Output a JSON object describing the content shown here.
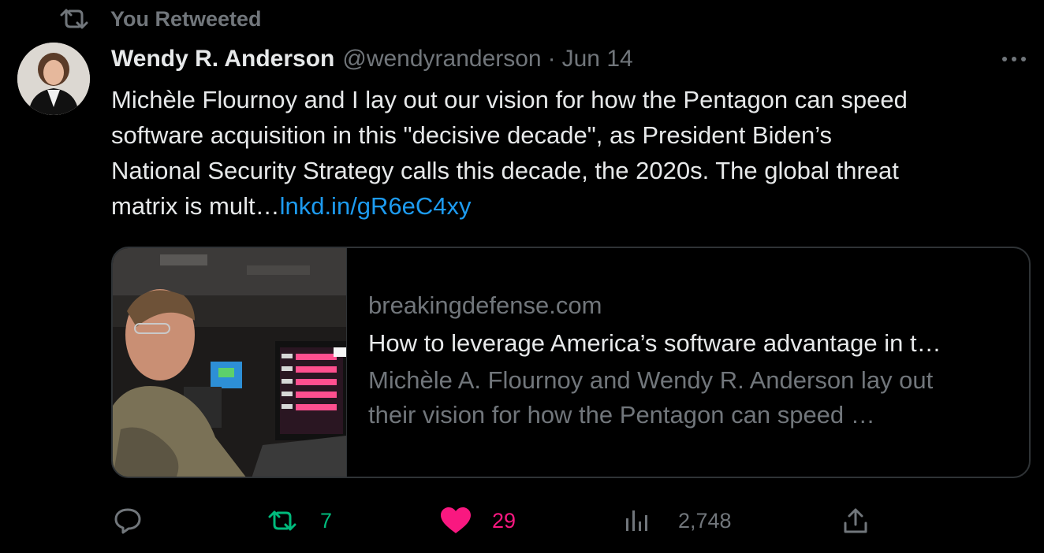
{
  "social_context": {
    "text": "You Retweeted",
    "icon": "retweet-icon"
  },
  "author": {
    "name": "Wendy R. Anderson",
    "handle": "@wendyranderson",
    "separator": "·",
    "date": "Jun 14"
  },
  "tweet": {
    "lines": [
      "Michèle Flournoy and I lay out our vision for how the Pentagon can speed",
      "software acquisition in this \"decisive decade\", as President Biden’s",
      "National Security Strategy calls this decade, the 2020s. The global threat"
    ],
    "last_line_prefix": "matrix is mult…",
    "link": "lnkd.in/gR6eC4xy"
  },
  "card": {
    "domain": "breakingdefense.com",
    "title": "How to leverage America’s software advantage in t…",
    "description_lines": [
      "Michèle A. Flournoy and Wendy R. Anderson lay out",
      "their vision for how the Pentagon can speed …"
    ]
  },
  "actions": {
    "reply": {
      "icon": "reply-icon"
    },
    "retweet": {
      "icon": "retweet-icon",
      "count": "7"
    },
    "like": {
      "icon": "heart-icon",
      "count": "29"
    },
    "views": {
      "icon": "views-icon",
      "count": "2,748"
    },
    "share": {
      "icon": "share-icon"
    }
  },
  "colors": {
    "background": "#000000",
    "text_primary": "#e7e9ea",
    "text_secondary": "#71767b",
    "link": "#1d9bf0",
    "retweet_active": "#00ba7c",
    "like_active": "#f91880",
    "border": "#2f3336"
  }
}
